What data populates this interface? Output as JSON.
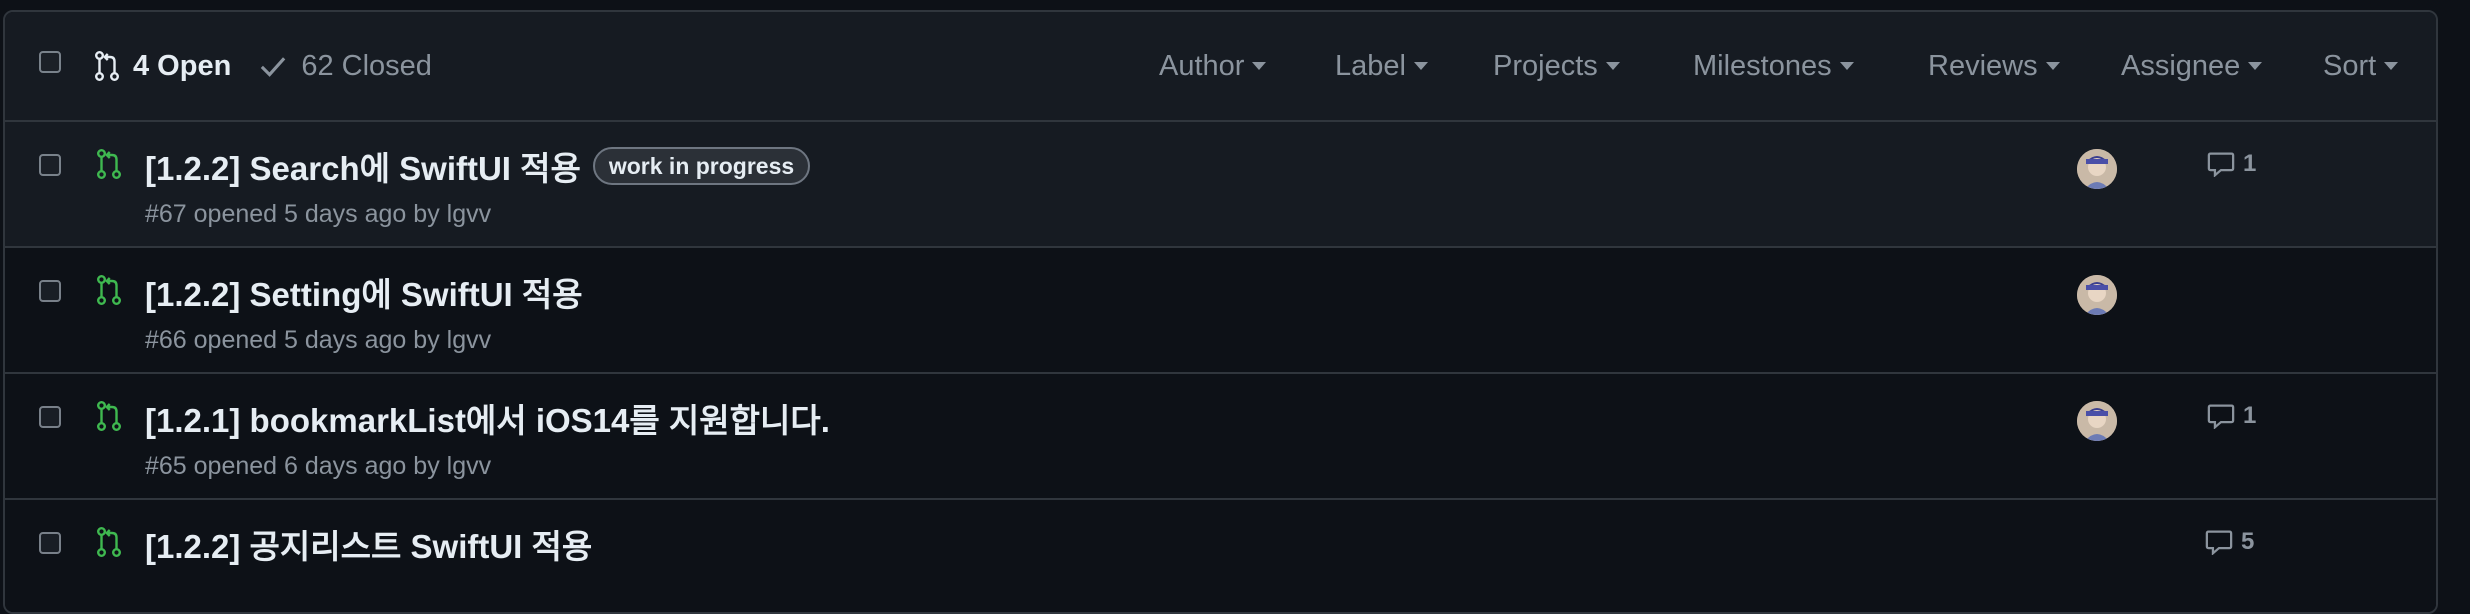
{
  "header": {
    "open_label": "4 Open",
    "closed_label": "62 Closed",
    "filters": {
      "author": "Author",
      "label": "Label",
      "projects": "Projects",
      "milestones": "Milestones",
      "reviews": "Reviews",
      "assignee": "Assignee",
      "sort": "Sort"
    }
  },
  "colors": {
    "open_icon": "#3fb950",
    "background": "#0d1117",
    "header_bg": "#161b22",
    "border": "#30363d",
    "muted_text": "#8b949e"
  },
  "pull_requests": [
    {
      "title": "[1.2.2] Search에 SwiftUI 적용",
      "label": "work in progress",
      "meta": "#67 opened 5 days ago by ",
      "author": "lgvv",
      "comments": "1"
    },
    {
      "title": "[1.2.2] Setting에 SwiftUI 적용",
      "meta": "#66 opened 5 days ago by ",
      "author": "lgvv"
    },
    {
      "title": "[1.2.1] bookmarkList에서 iOS14를 지원합니다.",
      "meta": "#65 opened 6 days ago by ",
      "author": "lgvv",
      "comments": "1"
    },
    {
      "title": "[1.2.2] 공지리스트 SwiftUI 적용",
      "comments": "5"
    }
  ]
}
